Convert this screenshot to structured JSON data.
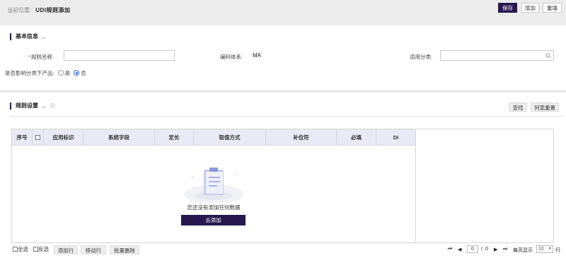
{
  "breadcrumb": {
    "prefix": "当前位置:",
    "current": "UDI规则添加"
  },
  "toolbar": {
    "save": "保存",
    "add": "增加",
    "reset": "重填"
  },
  "basic": {
    "title": "基本信息",
    "rule_name_label": "规则名称:",
    "rule_name_value": "",
    "code_system_label": "编码体系:",
    "code_system_value": "MA",
    "category_label": "适用分类:",
    "category_value": "",
    "affect_label": "是否影响分类下产品:",
    "opt_yes": "是",
    "opt_no": "否",
    "selected": "否"
  },
  "rules": {
    "title": "规则设置",
    "search": "查找",
    "reset_cols": "列宽重置",
    "columns": [
      "序号",
      "",
      "应用标识",
      "系统字段",
      "定长",
      "取值方式",
      "补位符",
      "必填",
      "DI"
    ],
    "rows": [],
    "empty_text": "您还没有添加任何数据",
    "add_now": "去添加"
  },
  "footer": {
    "select_all": "全选",
    "invert": "反选",
    "add_row": "添加行",
    "move_row": "移动行",
    "bulk_delete": "批量删除"
  },
  "pager": {
    "page": "0",
    "sep": "/",
    "total": "0",
    "per_page_label": "每页显示",
    "per_page": "10",
    "rows_suffix": "行"
  },
  "colors": {
    "primary": "#26184f",
    "header_bg": "#e8eaf5",
    "radio_on": "#2a6ae8",
    "required": "#e33333"
  }
}
